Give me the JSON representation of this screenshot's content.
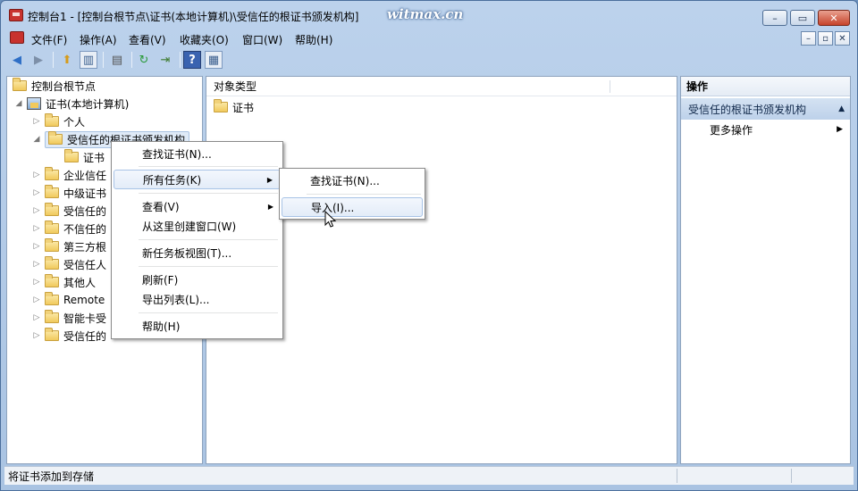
{
  "window": {
    "title": "控制台1 - [控制台根节点\\证书(本地计算机)\\受信任的根证书颁发机构]",
    "watermark": "witmax.cn",
    "caption_min": "–",
    "caption_max": "▭",
    "caption_close": "✕"
  },
  "menubar": {
    "items": [
      "文件(F)",
      "操作(A)",
      "查看(V)",
      "收藏夹(O)",
      "窗口(W)",
      "帮助(H)"
    ],
    "mdi_min": "–",
    "mdi_restore": "▫",
    "mdi_close": "✕"
  },
  "toolbar": {
    "icons": [
      "back-icon",
      "forward-icon",
      "up-folder-icon",
      "show-tree-icon",
      "properties-icon",
      "refresh-icon",
      "export-list-icon",
      "help-icon",
      "action-pane-icon"
    ]
  },
  "tree": {
    "root": "控制台根节点",
    "cert_local": "证书(本地计算机)",
    "nodes": [
      "个人",
      "受信任的根证书颁发机构",
      "证书",
      "企业信任",
      "中级证书",
      "受信任的",
      "不信任的",
      "第三方根",
      "受信任人",
      "其他人",
      "Remote",
      "智能卡受",
      "受信任的"
    ]
  },
  "content": {
    "column_header": "对象类型",
    "items": [
      "证书"
    ]
  },
  "actions": {
    "header": "操作",
    "section": "受信任的根证书颁发机构",
    "more": "更多操作"
  },
  "context_menu": {
    "items": [
      "查找证书(N)...",
      "所有任务(K)",
      "查看(V)",
      "从这里创建窗口(W)",
      "新任务板视图(T)...",
      "刷新(F)",
      "导出列表(L)...",
      "帮助(H)"
    ]
  },
  "submenu": {
    "items": [
      "查找证书(N)...",
      "导入(I)..."
    ]
  },
  "status": {
    "text": "将证书添加到存储"
  }
}
